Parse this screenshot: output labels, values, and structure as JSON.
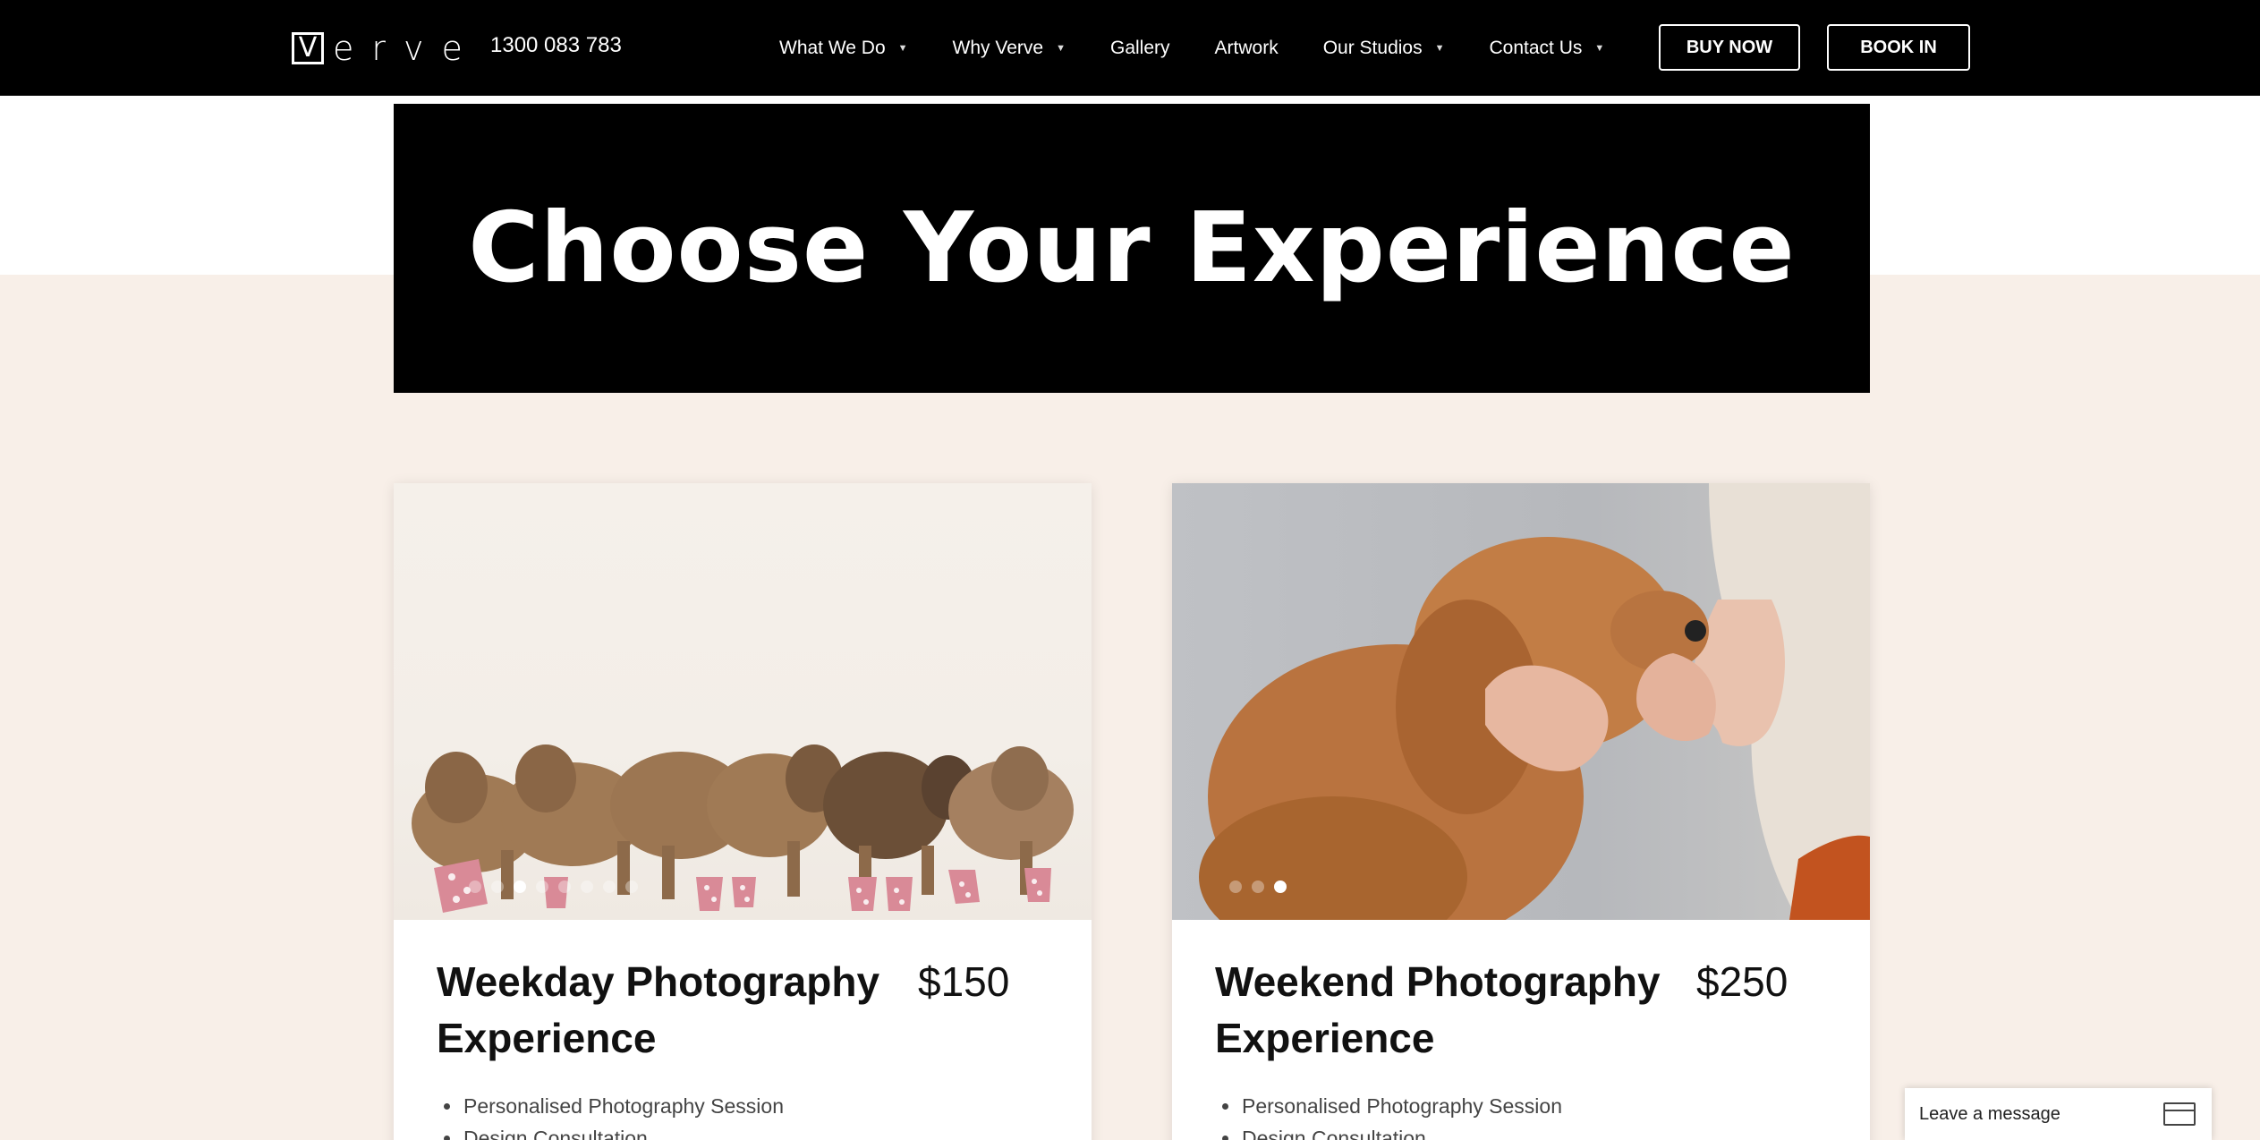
{
  "header": {
    "logo_first_letter": "V",
    "logo_rest": "erve",
    "phone": "1300 083 783",
    "nav": [
      {
        "label": "What We Do",
        "has_dropdown": true
      },
      {
        "label": "Why Verve",
        "has_dropdown": true
      },
      {
        "label": "Gallery",
        "has_dropdown": false
      },
      {
        "label": "Artwork",
        "has_dropdown": false
      },
      {
        "label": "Our Studios",
        "has_dropdown": true
      },
      {
        "label": "Contact Us",
        "has_dropdown": true
      }
    ],
    "buy_now": "BUY NOW",
    "book_in": "BOOK IN"
  },
  "hero": {
    "title": "Choose Your Experience"
  },
  "cards": [
    {
      "title": "Weekday Photography Experience",
      "price": "$150",
      "image": "puppies-photo",
      "features": [
        "Personalised Photography Session",
        "Design Consultation"
      ]
    },
    {
      "title": "Weekend Photography Experience",
      "price": "$250",
      "image": "dog-kiss-photo",
      "features": [
        "Personalised Photography Session",
        "Design Consultation"
      ]
    }
  ],
  "chat": {
    "label": "Leave a message",
    "icon": "message-icon"
  },
  "colors": {
    "header_bg": "#000000",
    "hero_bg": "#000000",
    "page_bg": "#f8efe8",
    "card_bg": "#ffffff"
  }
}
